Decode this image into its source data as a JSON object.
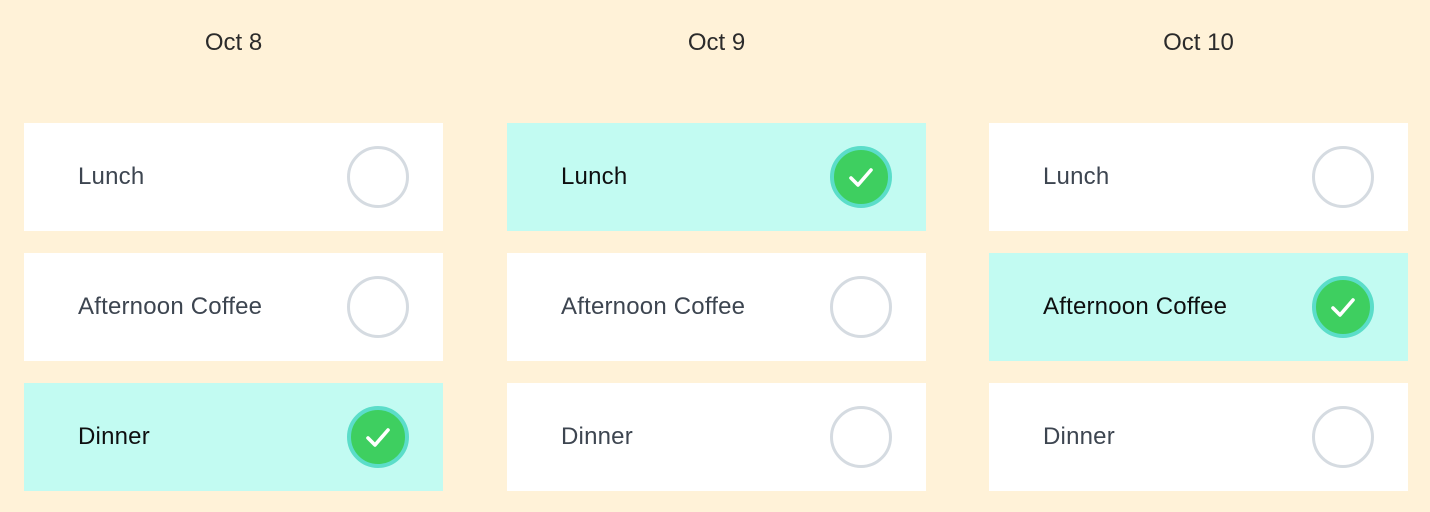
{
  "days": [
    {
      "date": "Oct 8",
      "options": [
        {
          "label": "Lunch",
          "selected": false
        },
        {
          "label": "Afternoon Coffee",
          "selected": false
        },
        {
          "label": "Dinner",
          "selected": true
        }
      ]
    },
    {
      "date": "Oct 9",
      "options": [
        {
          "label": "Lunch",
          "selected": true
        },
        {
          "label": "Afternoon Coffee",
          "selected": false
        },
        {
          "label": "Dinner",
          "selected": false
        }
      ]
    },
    {
      "date": "Oct 10",
      "options": [
        {
          "label": "Lunch",
          "selected": false
        },
        {
          "label": "Afternoon Coffee",
          "selected": true
        },
        {
          "label": "Dinner",
          "selected": false
        }
      ]
    }
  ],
  "colors": {
    "background": "#fff2d8",
    "card": "#ffffff",
    "selected_card": "#c2fbf2",
    "check_fill": "#3ecf60",
    "check_ring": "#5bddc9",
    "radio_border": "#d5dbe1"
  },
  "icons": {
    "selected": "checkmark-icon",
    "unselected": "empty-radio-icon"
  }
}
